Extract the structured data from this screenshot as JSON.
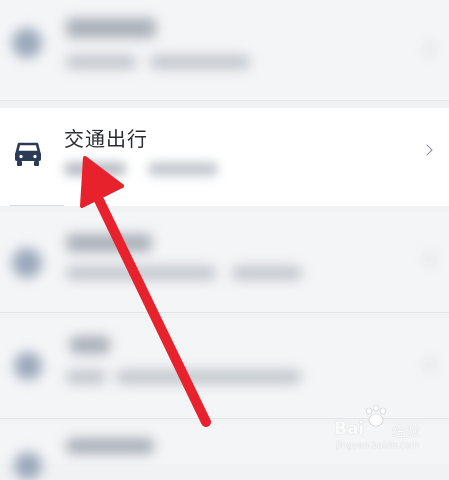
{
  "focus_item": {
    "title": "交通出行",
    "icon": "car-icon"
  },
  "watermark": {
    "brand": "Bai",
    "product": "经验",
    "url": "jingyan.baidu.com"
  },
  "colors": {
    "arrow": "#e8222d",
    "icon": "#2b3a55",
    "focus_background": "#ffffff",
    "page_background": "#f1f2f4"
  }
}
